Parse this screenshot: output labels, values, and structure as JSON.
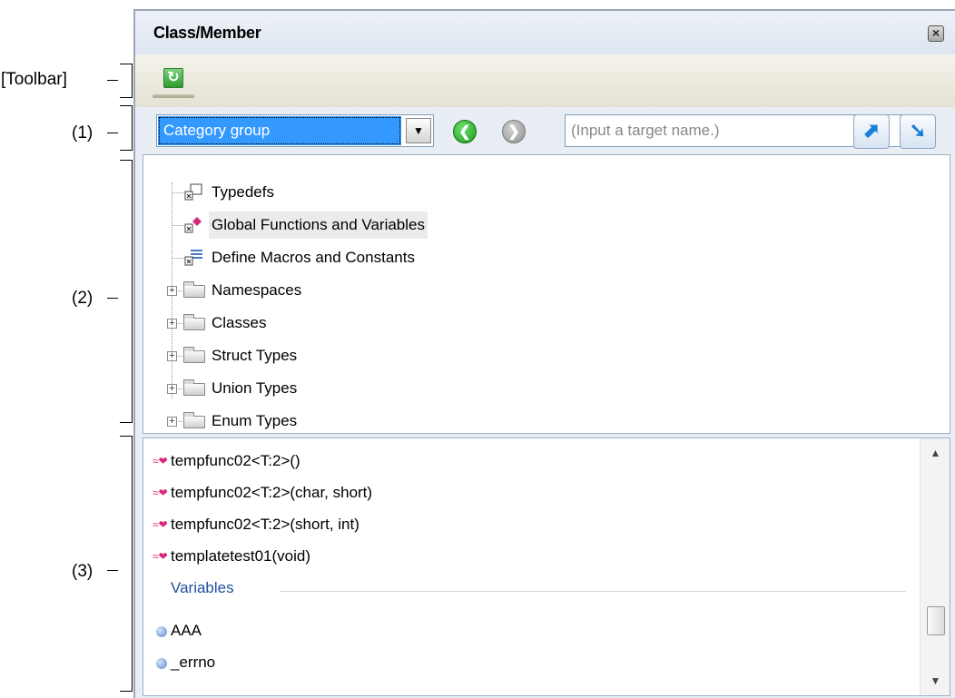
{
  "annotations": {
    "toolbar": "[Toolbar]",
    "area1": "(1)",
    "area2": "(2)",
    "area3": "(3)"
  },
  "panel": {
    "title": "Class/Member",
    "close_icon": "close-icon"
  },
  "toolbar": {
    "refresh_icon": "refresh-icon"
  },
  "navbar": {
    "display_mode": "Category group",
    "target_placeholder": "(Input a target name.)",
    "target_value": ""
  },
  "tree": {
    "items": [
      {
        "label": "Typedefs",
        "icon": "typedef-icon",
        "expandable": false
      },
      {
        "label": "Global Functions and Variables",
        "icon": "global-icon",
        "expandable": false,
        "highlighted": true
      },
      {
        "label": "Define Macros and Constants",
        "icon": "macro-icon",
        "expandable": false
      },
      {
        "label": "Namespaces",
        "icon": "folder-icon",
        "expandable": true
      },
      {
        "label": "Classes",
        "icon": "folder-icon",
        "expandable": true
      },
      {
        "label": "Struct Types",
        "icon": "folder-icon",
        "expandable": true
      },
      {
        "label": "Union Types",
        "icon": "folder-icon",
        "expandable": true
      },
      {
        "label": "Enum Types",
        "icon": "folder-icon",
        "expandable": true
      }
    ]
  },
  "list": {
    "functions": [
      "tempfunc02<T:2>()",
      "tempfunc02<T:2>(char, short)",
      "tempfunc02<T:2>(short, int)",
      "templatetest01(void)"
    ],
    "group_label": "Variables",
    "variables": [
      "AAA",
      "_errno"
    ]
  },
  "colors": {
    "selection": "#3399ff",
    "function_icon": "#d6287c",
    "group_label": "#1f4e9c"
  }
}
